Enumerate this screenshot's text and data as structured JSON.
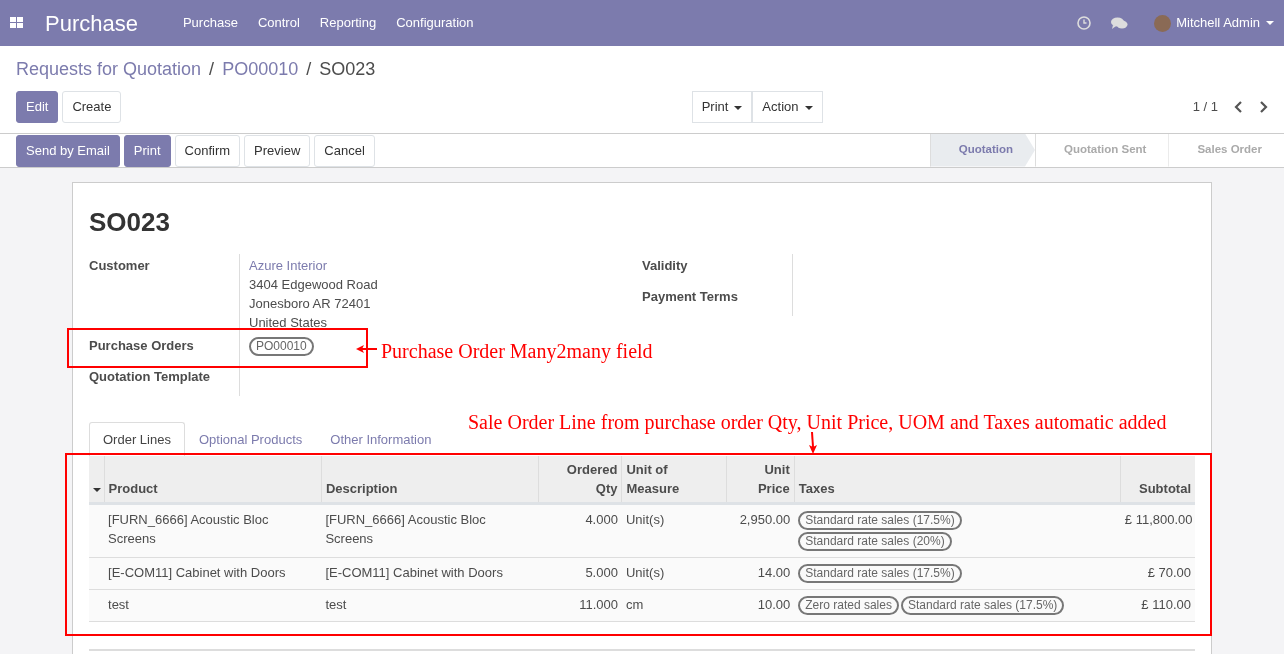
{
  "navbar": {
    "app_title": "Purchase",
    "menu": [
      "Purchase",
      "Control",
      "Reporting",
      "Configuration"
    ],
    "user": "Mitchell Admin"
  },
  "breadcrumb": [
    {
      "kind": "link",
      "label": "Requests for Quotation"
    },
    {
      "kind": "separator",
      "label": "/"
    },
    {
      "kind": "link",
      "label": "PO00010"
    },
    {
      "kind": "separator",
      "label": "/"
    },
    {
      "kind": "current",
      "label": "SO023"
    }
  ],
  "control_buttons": [
    {
      "label": "Edit",
      "primary": true
    },
    {
      "label": "Create",
      "primary": false
    }
  ],
  "dropdowns": [
    "Print",
    "Action"
  ],
  "pager": "1 / 1",
  "header_buttons": [
    {
      "label": "Send by Email",
      "primary": true
    },
    {
      "label": "Print",
      "primary": true
    },
    {
      "label": "Confirm",
      "primary": false
    },
    {
      "label": "Preview",
      "primary": false
    },
    {
      "label": "Cancel",
      "primary": false
    }
  ],
  "stages": [
    {
      "label": "Quotation",
      "selected": true
    },
    {
      "label": "Quotation Sent",
      "selected": false
    },
    {
      "label": "Sales Order",
      "selected": false
    }
  ],
  "record_title": "SO023",
  "left_fields": [
    {
      "label": "Customer",
      "kind": "address",
      "link": "Azure Interior",
      "lines": [
        "3404 Edgewood Road",
        "Jonesboro AR 72401",
        "United States"
      ]
    },
    {
      "label": "Purchase Orders",
      "kind": "tags",
      "tags": [
        "PO00010"
      ]
    },
    {
      "label": "Quotation Template",
      "kind": "empty"
    }
  ],
  "right_fields": [
    {
      "label": "Validity"
    },
    {
      "label": "Payment Terms"
    }
  ],
  "tabs": [
    {
      "label": "Order Lines",
      "selected": true
    },
    {
      "label": "Optional Products",
      "selected": false
    },
    {
      "label": "Other Information",
      "selected": false
    }
  ],
  "table": {
    "columns": [
      {
        "lines": [
          "Product"
        ]
      },
      {
        "lines": [
          "Description"
        ]
      },
      {
        "lines": [
          "Ordered",
          "Qty"
        ]
      },
      {
        "lines": [
          "Unit of",
          "Measure"
        ]
      },
      {
        "lines": [
          "Unit",
          "Price"
        ]
      },
      {
        "lines": [
          "Taxes"
        ]
      },
      {
        "lines": [
          "Subtotal"
        ]
      }
    ],
    "rows": [
      {
        "product": "[FURN_6666] Acoustic Bloc Screens",
        "description": "[FURN_6666] Acoustic Bloc Screens",
        "qty": "4.000",
        "uom": "Unit(s)",
        "price": "2,950.00",
        "taxes": [
          "Standard rate sales (17.5%)",
          "Standard rate sales (20%)"
        ],
        "subtotal": "£ 11,800.00"
      },
      {
        "product": "[E-COM11] Cabinet with Doors",
        "description": "[E-COM11] Cabinet with Doors",
        "qty": "5.000",
        "uom": "Unit(s)",
        "price": "14.00",
        "taxes": [
          "Standard rate sales (17.5%)"
        ],
        "subtotal": "£ 70.00"
      },
      {
        "product": "test",
        "description": "test",
        "qty": "11.000",
        "uom": "cm",
        "price": "10.00",
        "taxes": [
          "Zero rated sales",
          "Standard rate sales (17.5%)"
        ],
        "subtotal": "£ 110.00"
      }
    ]
  },
  "annotations": [
    "Purchase Order Many2many field",
    "Sale Order Line from purchase order Qty, Unit Price, UOM and Taxes automatic added"
  ]
}
